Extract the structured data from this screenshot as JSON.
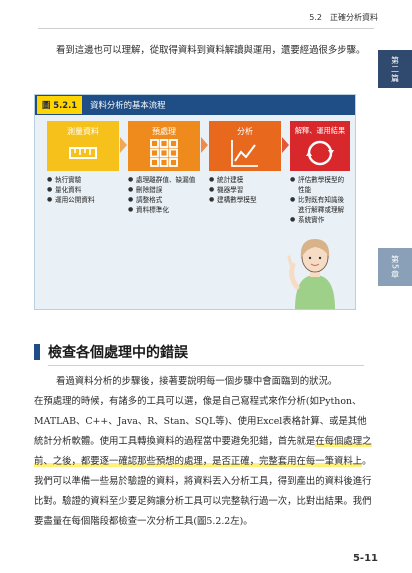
{
  "header": {
    "title": "5.2　正確分析資料"
  },
  "side_tabs": {
    "part": "第二篇",
    "chapter": "第5章"
  },
  "intro": "看到這邊也可以理解，從取得資料到資料解讀與運用，還要經過很多步驟。",
  "figure": {
    "number": "圖 5.2.1",
    "title": "資料分析的基本流程",
    "stages": [
      {
        "label": "測量資料",
        "color": "#f5c11a",
        "icon": "ruler-icon",
        "items": [
          "執行實驗",
          "量化資料",
          "運用公開資料"
        ]
      },
      {
        "label": "預處理",
        "color": "#ef8a1c",
        "icon": "grid-icon",
        "items": [
          "處理離群值、缺漏值",
          "刪除錯誤",
          "調整格式",
          "資料標準化"
        ]
      },
      {
        "label": "分析",
        "color": "#e8681d",
        "icon": "line-chart-icon",
        "items": [
          "統計建模",
          "機器學習",
          "建構數學模型"
        ]
      },
      {
        "label": "解釋、運用結果",
        "color": "#d8282b",
        "icon": "cycle-arrows-icon",
        "items": [
          "評估數學模型的性能",
          "比對既有知識後進行解釋或理解",
          "系統實作"
        ]
      }
    ]
  },
  "section": {
    "title": "檢查各個處理中的錯誤"
  },
  "body": {
    "first_line": "看過資料分析的步驟後，接著要說明每一個步驟中會面臨到的狀況。",
    "rest_before": "在預處理的時候，有諸多的工具可以選，像是自己寫程式來作分析(如Python、MATLAB、C++、Java、R、Stan、SQL等)、使用Excel表格計算、或是其他統計分析軟體。使用工具轉換資料的過程當中要避免犯錯，首先就是",
    "highlight": "在每個處理之前、之後，都要逐一確認那些預想的處理，是否正確，完整套用在每一筆資料上",
    "rest_after": "。我們可以準備一些易於驗證的資料，將資料丟入分析工具，得到產出的資料後進行比對。驗證的資料至少要足夠讓分析工具可以完整執行過一次，比對出結果。我們要盡量在每個階段都檢查一次分析工具(圖5.2.2左)。"
  },
  "page_number": "5-11"
}
